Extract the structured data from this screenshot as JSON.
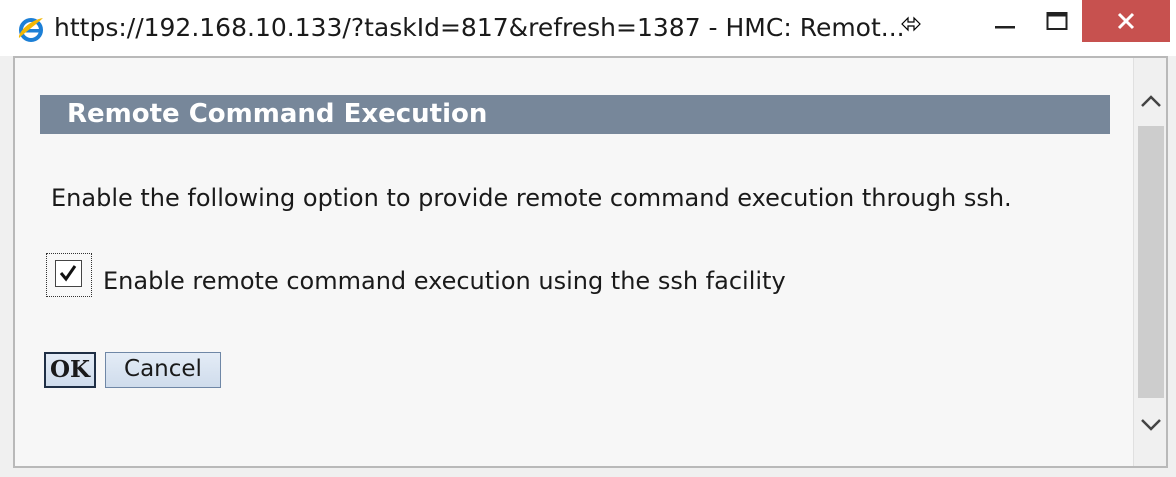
{
  "window": {
    "title": "https://192.168.10.133/?taskId=817&refresh=1387 - HMC: Remot...",
    "icon": "internet-explorer-icon",
    "controls": [
      "minimize-icon",
      "maximize-icon",
      "close-icon"
    ]
  },
  "dialog": {
    "header_title": "Remote Command Execution",
    "description": "Enable the following option to provide remote command execution through ssh.",
    "checkbox": {
      "label": "Enable remote command execution using the ssh facility",
      "checked": true
    },
    "buttons": {
      "ok_label": "OK",
      "cancel_label": "Cancel"
    }
  },
  "colors": {
    "header_bar": "#77879a",
    "close_button": "#c7514f"
  }
}
